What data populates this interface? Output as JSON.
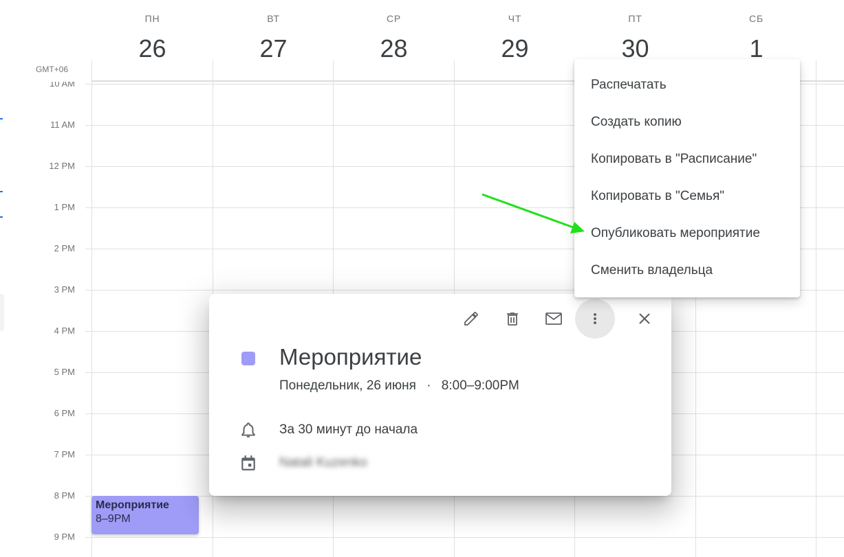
{
  "header": {
    "days": [
      {
        "name": "ПН",
        "num": "26"
      },
      {
        "name": "ВТ",
        "num": "27"
      },
      {
        "name": "СР",
        "num": "28"
      },
      {
        "name": "ЧТ",
        "num": "29"
      },
      {
        "name": "ПТ",
        "num": "30"
      },
      {
        "name": "СБ",
        "num": "1"
      }
    ],
    "timezone": "GMT+06"
  },
  "grid": {
    "hours": [
      "10 AM",
      "11 AM",
      "12 PM",
      "1 PM",
      "2 PM",
      "3 PM",
      "4 PM",
      "5 PM",
      "6 PM",
      "7 PM",
      "8 PM",
      "9 PM"
    ]
  },
  "event_chip": {
    "title": "Мероприятие",
    "time": "8–9PM"
  },
  "popover": {
    "toolbar_icons": [
      "pencil-icon",
      "trash-icon",
      "mail-icon",
      "more-vert-icon",
      "close-icon"
    ],
    "title": "Мероприятие",
    "date": "Понедельник, 26 июня",
    "separator": "·",
    "time": "8:00–9:00PM",
    "reminder": "За 30 минут до начала",
    "calendar_owner": "Natali Kuzenko",
    "event_color": "#9e9cf6"
  },
  "menu": {
    "items": [
      "Распечатать",
      "Создать копию",
      "Копировать в \"Расписание\"",
      "Копировать в \"Семья\"",
      "Опубликовать мероприятие",
      "Сменить владельца"
    ]
  },
  "colors": {
    "annotation_arrow": "#22e01a",
    "grid_line": "#e0e0e0"
  }
}
